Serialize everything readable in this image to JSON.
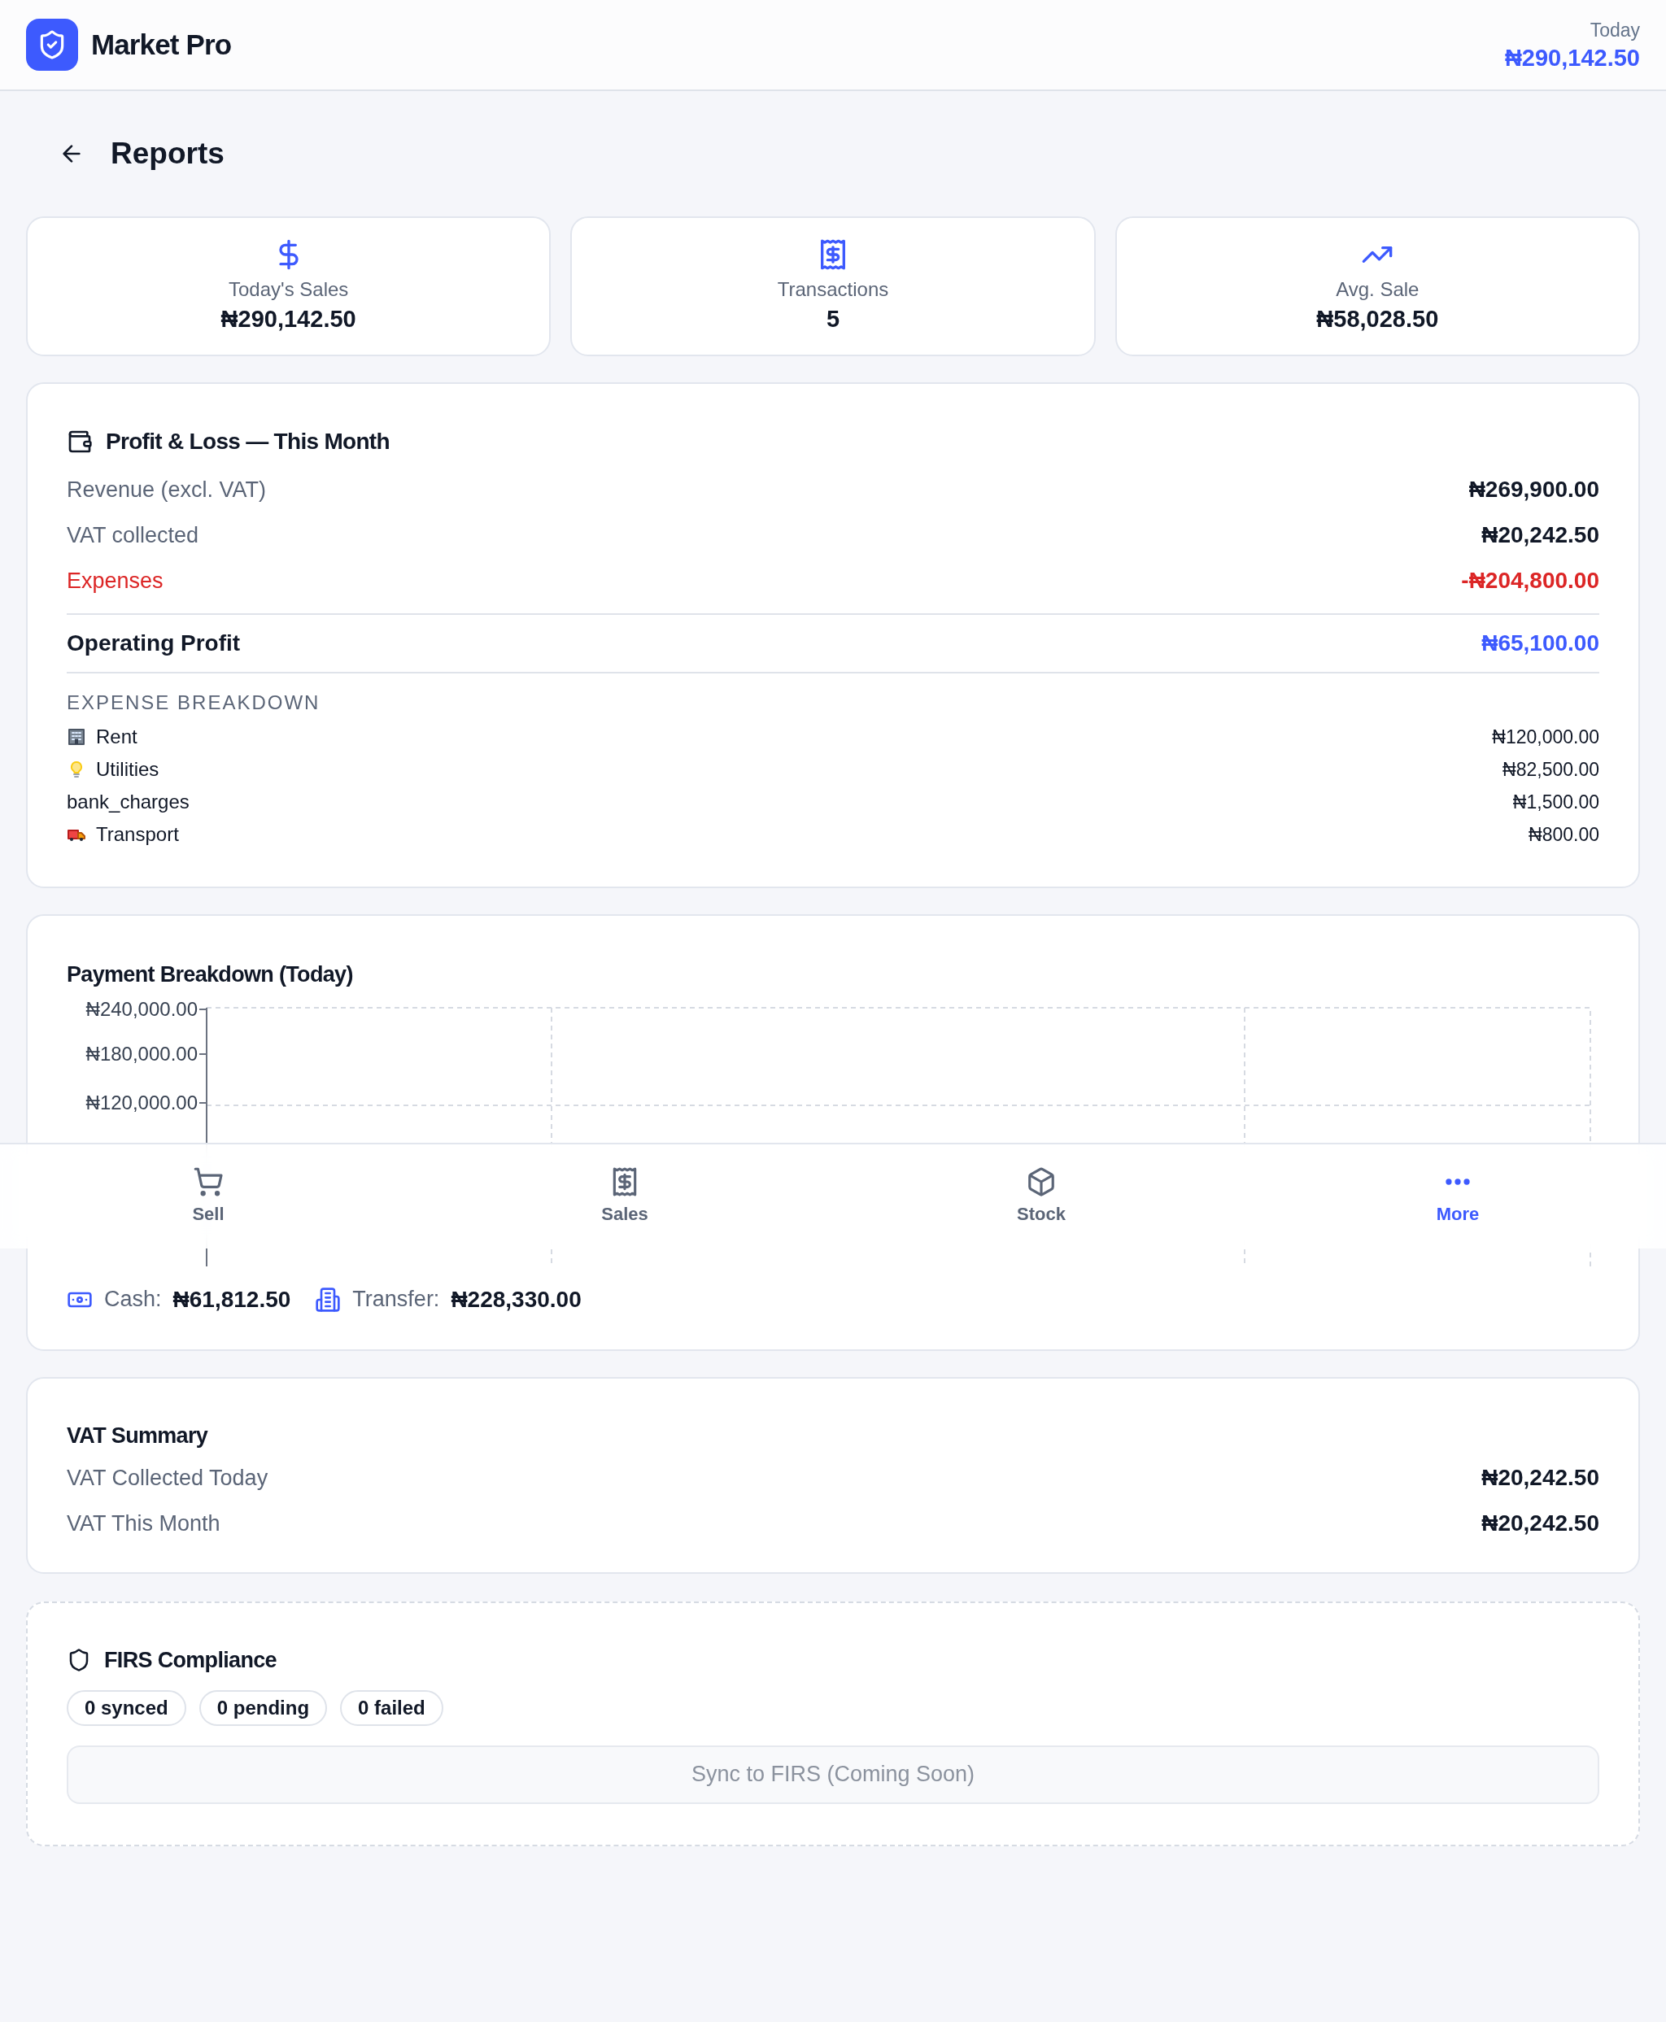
{
  "app": {
    "name": "Market Pro",
    "today_label": "Today",
    "today_amount": "₦290,142.50"
  },
  "page": {
    "title": "Reports"
  },
  "stats": [
    {
      "kind": "dollar",
      "label": "Today's Sales",
      "value": "₦290,142.50"
    },
    {
      "kind": "receipt",
      "label": "Transactions",
      "value": "5"
    },
    {
      "kind": "trend",
      "label": "Avg. Sale",
      "value": "₦58,028.50"
    }
  ],
  "profit_loss": {
    "title": "Profit & Loss — This Month",
    "rows": [
      {
        "label": "Revenue (excl. VAT)",
        "value": "₦269,900.00",
        "kind": "normal"
      },
      {
        "label": "VAT collected",
        "value": "₦20,242.50",
        "kind": "normal"
      },
      {
        "label": "Expenses",
        "value": "-₦204,800.00",
        "kind": "negative"
      }
    ],
    "total": {
      "label": "Operating Profit",
      "value": "₦65,100.00"
    },
    "breakdown_title": "EXPENSE BREAKDOWN",
    "breakdown": [
      {
        "kind": "building",
        "label": "Rent",
        "value": "₦120,000.00"
      },
      {
        "kind": "bulb",
        "label": "Utilities",
        "value": "₦82,500.00"
      },
      {
        "kind": "plain",
        "label": "bank_charges",
        "value": "₦1,500.00"
      },
      {
        "kind": "truck",
        "label": "Transport",
        "value": "₦800.00"
      }
    ]
  },
  "payment_breakdown": {
    "title": "Payment Breakdown (Today)",
    "y_axis_labels": [
      "₦240,000.00",
      "₦180,000.00",
      "₦120,000.00"
    ],
    "totals": [
      {
        "kind": "cash",
        "label": "Cash:",
        "value": "₦61,812.50"
      },
      {
        "kind": "bank",
        "label": "Transfer:",
        "value": "₦228,330.00"
      }
    ]
  },
  "vat_summary": {
    "title": "VAT Summary",
    "rows": [
      {
        "label": "VAT Collected Today",
        "value": "₦20,242.50"
      },
      {
        "label": "VAT This Month",
        "value": "₦20,242.50"
      }
    ]
  },
  "firs": {
    "title": "FIRS Compliance",
    "badges": [
      "0 synced",
      "0 pending",
      "0 failed"
    ],
    "button": {
      "label": "Sync to FIRS (Coming Soon)",
      "disabled": true
    }
  },
  "bottom_nav": [
    {
      "kind": "cart",
      "label": "Sell",
      "selected": false
    },
    {
      "kind": "receipt",
      "label": "Sales",
      "selected": false
    },
    {
      "kind": "box",
      "label": "Stock",
      "selected": false
    },
    {
      "kind": "dots",
      "label": "More",
      "selected": true
    }
  ]
}
